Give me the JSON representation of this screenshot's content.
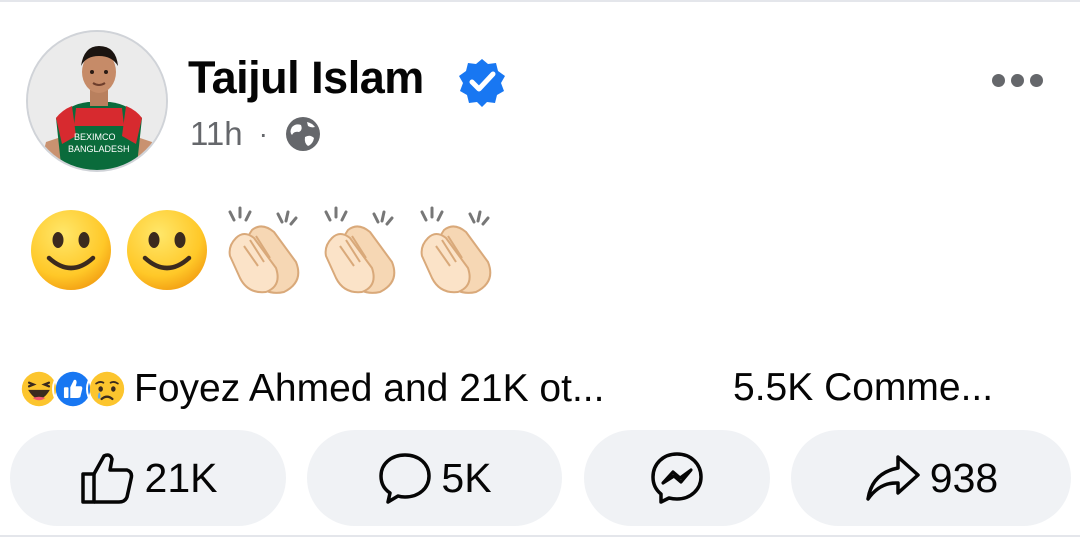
{
  "author": {
    "name": "Taijul Islam",
    "verified": true,
    "jersey_text": [
      "BEXIMCO",
      "BANGLADESH"
    ]
  },
  "meta": {
    "time": "11h",
    "separator": "·",
    "audience_icon": "globe-icon"
  },
  "post": {
    "emojis": [
      "slightly-smiling-face",
      "slightly-smiling-face",
      "clapping-hands",
      "clapping-hands",
      "clapping-hands"
    ]
  },
  "reactions": {
    "icons": [
      "haha-reaction",
      "like-reaction",
      "sad-reaction"
    ],
    "summary": "Foyez Ahmed and 21K ot...",
    "comments_summary": "5.5K Comme..."
  },
  "actions": {
    "like_count": "21K",
    "comment_count": "5K",
    "share_count": "938"
  },
  "colors": {
    "accent": "#1877f2",
    "secondary_text": "#65676b",
    "pill_bg": "#f0f2f5",
    "jersey_green": "#0a6b3b",
    "jersey_red": "#d72a2f"
  }
}
